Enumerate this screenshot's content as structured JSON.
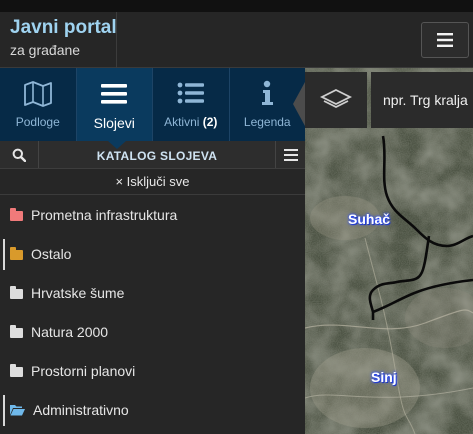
{
  "header": {
    "title": "Javni portal",
    "subtitle": "za građane",
    "menu_icon": "hamburger-icon"
  },
  "tabs": [
    {
      "label": "Podloge",
      "icon": "map-icon",
      "active": false
    },
    {
      "label": "Slojevi",
      "icon": "layers-list-icon",
      "active": true
    },
    {
      "label": "Aktivni",
      "badge": "(2)",
      "icon": "list-icon",
      "active": false
    },
    {
      "label": "Legenda",
      "icon": "info-icon",
      "active": false
    }
  ],
  "catalog": {
    "title": "KATALOG SLOJEVA",
    "clear_all": "× Isključi sve"
  },
  "layers": [
    {
      "name": "Prometna infrastruktura",
      "folder_color": "#f07a7a",
      "open": false
    },
    {
      "name": "Ostalo",
      "folder_color": "#d99a2b",
      "open": false
    },
    {
      "name": "Hrvatske šume",
      "folder_color": "#dddddd",
      "open": false
    },
    {
      "name": "Natura 2000",
      "folder_color": "#dddddd",
      "open": false
    },
    {
      "name": "Prostorni planovi",
      "folder_color": "#dddddd",
      "open": false
    },
    {
      "name": "Administrativno",
      "folder_color": "#6fb8ea",
      "open": true
    }
  ],
  "map": {
    "search_placeholder": "npr. Trg kralja",
    "places": [
      "Suhač",
      "Sinj"
    ]
  },
  "colors": {
    "brand_title": "#9fd3f0",
    "tab_bar": "#062a47",
    "tab_active": "#0a3a5e",
    "panel_bg": "#262626"
  }
}
